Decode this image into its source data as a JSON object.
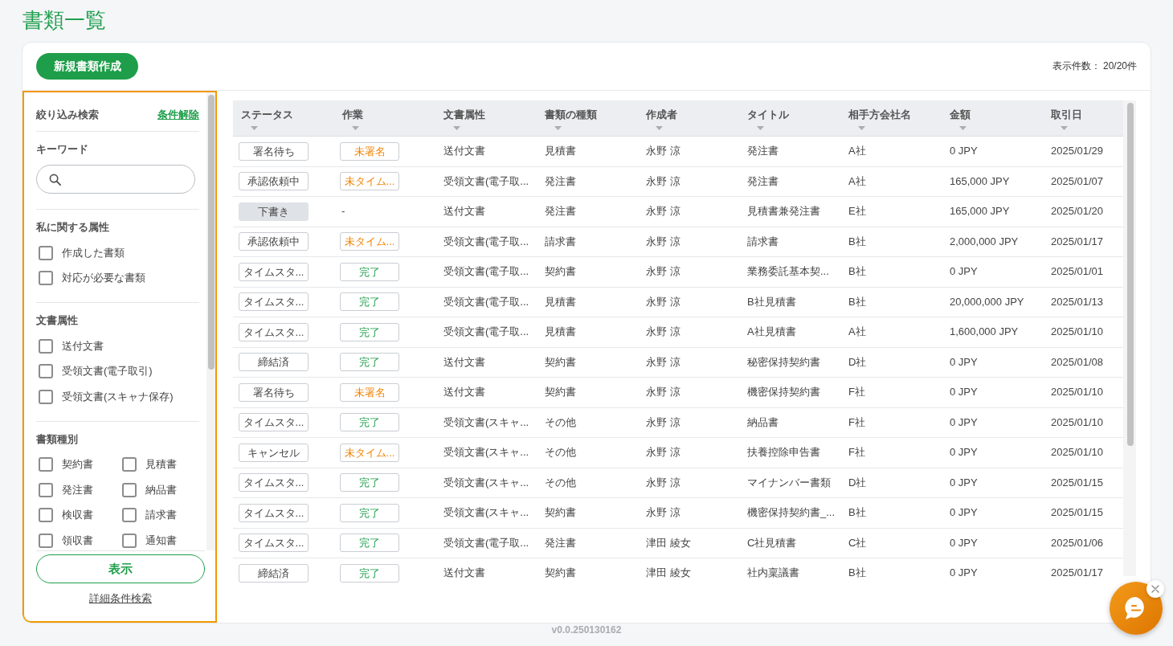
{
  "page": {
    "title": "書類一覧",
    "version": "v0.0.250130162"
  },
  "toolbar": {
    "create_button": "新規書類作成",
    "count": "表示件数： 20/20件"
  },
  "filter_panel": {
    "focused": true,
    "title": "絞り込み検索",
    "clear_link": "条件解除",
    "sections": [
      {
        "kind": "search",
        "heading": "キーワード"
      },
      {
        "kind": "checklist",
        "heading": "私に関する属性",
        "options": [
          {
            "label": "作成した書類",
            "checked": false
          },
          {
            "label": "対応が必要な書類",
            "checked": false
          }
        ]
      },
      {
        "kind": "checklist",
        "heading": "文書属性",
        "options": [
          {
            "label": "送付文書",
            "checked": false
          },
          {
            "label": "受領文書(電子取引)",
            "checked": false
          },
          {
            "label": "受領文書(スキャナ保存)",
            "checked": false
          }
        ]
      },
      {
        "kind": "grid",
        "heading": "書類種別",
        "options": [
          {
            "label": "契約書",
            "checked": false
          },
          {
            "label": "見積書",
            "checked": false
          },
          {
            "label": "発注書",
            "checked": false
          },
          {
            "label": "納品書",
            "checked": false
          },
          {
            "label": "検収書",
            "checked": false
          },
          {
            "label": "請求書",
            "checked": false
          },
          {
            "label": "領収書",
            "checked": false
          },
          {
            "label": "通知書",
            "checked": false
          }
        ]
      }
    ],
    "apply_button": "表示",
    "advanced_link": "詳細条件検索"
  },
  "table": {
    "columns": [
      "ステータス",
      "作業",
      "文書属性",
      "書類の種類",
      "作成者",
      "タイトル",
      "相手方会社名",
      "金額",
      "取引日"
    ],
    "rows": [
      {
        "status": {
          "label": "署名待ち",
          "kind": "normal"
        },
        "task": {
          "label": "未署名",
          "kind": "pending"
        },
        "attribute": "送付文書",
        "type": "見積書",
        "creator": "永野 涼",
        "title": "発注書",
        "partner": "A社",
        "amount": "0 JPY",
        "date": "2025/01/29"
      },
      {
        "status": {
          "label": "承認依頼中",
          "kind": "normal"
        },
        "task": {
          "label": "未タイム...",
          "kind": "pending"
        },
        "attribute": "受領文書(電子取...",
        "type": "発注書",
        "creator": "永野 涼",
        "title": "発注書",
        "partner": "A社",
        "amount": "165,000 JPY",
        "date": "2025/01/07"
      },
      {
        "status": {
          "label": "下書き",
          "kind": "draft"
        },
        "task": {
          "label": "-",
          "kind": "none"
        },
        "attribute": "送付文書",
        "type": "発注書",
        "creator": "永野 涼",
        "title": "見積書兼発注書",
        "partner": "E社",
        "amount": "165,000 JPY",
        "date": "2025/01/20"
      },
      {
        "status": {
          "label": "承認依頼中",
          "kind": "normal"
        },
        "task": {
          "label": "未タイム...",
          "kind": "pending"
        },
        "attribute": "受領文書(電子取...",
        "type": "請求書",
        "creator": "永野 涼",
        "title": "請求書",
        "partner": "B社",
        "amount": "2,000,000 JPY",
        "date": "2025/01/17"
      },
      {
        "status": {
          "label": "タイムスタ...",
          "kind": "normal"
        },
        "task": {
          "label": "完了",
          "kind": "done"
        },
        "attribute": "受領文書(電子取...",
        "type": "契約書",
        "creator": "永野 涼",
        "title": "業務委託基本契...",
        "partner": "B社",
        "amount": "0 JPY",
        "date": "2025/01/01"
      },
      {
        "status": {
          "label": "タイムスタ...",
          "kind": "normal"
        },
        "task": {
          "label": "完了",
          "kind": "done"
        },
        "attribute": "受領文書(電子取...",
        "type": "見積書",
        "creator": "永野 涼",
        "title": "B社見積書",
        "partner": "B社",
        "amount": "20,000,000 JPY",
        "date": "2025/01/13"
      },
      {
        "status": {
          "label": "タイムスタ...",
          "kind": "normal"
        },
        "task": {
          "label": "完了",
          "kind": "done"
        },
        "attribute": "受領文書(電子取...",
        "type": "見積書",
        "creator": "永野 涼",
        "title": "A社見積書",
        "partner": "A社",
        "amount": "1,600,000 JPY",
        "date": "2025/01/10"
      },
      {
        "status": {
          "label": "締結済",
          "kind": "normal"
        },
        "task": {
          "label": "完了",
          "kind": "done"
        },
        "attribute": "送付文書",
        "type": "契約書",
        "creator": "永野 涼",
        "title": "秘密保持契約書",
        "partner": "D社",
        "amount": "0 JPY",
        "date": "2025/01/08"
      },
      {
        "status": {
          "label": "署名待ち",
          "kind": "normal"
        },
        "task": {
          "label": "未署名",
          "kind": "pending"
        },
        "attribute": "送付文書",
        "type": "契約書",
        "creator": "永野 涼",
        "title": "機密保持契約書",
        "partner": "F社",
        "amount": "0 JPY",
        "date": "2025/01/10"
      },
      {
        "status": {
          "label": "タイムスタ...",
          "kind": "normal"
        },
        "task": {
          "label": "完了",
          "kind": "done"
        },
        "attribute": "受領文書(スキャ...",
        "type": "その他",
        "creator": "永野 涼",
        "title": "納品書",
        "partner": "F社",
        "amount": "0 JPY",
        "date": "2025/01/10"
      },
      {
        "status": {
          "label": "キャンセル",
          "kind": "normal"
        },
        "task": {
          "label": "未タイム...",
          "kind": "pending"
        },
        "attribute": "受領文書(スキャ...",
        "type": "その他",
        "creator": "永野 涼",
        "title": "扶養控除申告書",
        "partner": "F社",
        "amount": "0 JPY",
        "date": "2025/01/10"
      },
      {
        "status": {
          "label": "タイムスタ...",
          "kind": "normal"
        },
        "task": {
          "label": "完了",
          "kind": "done"
        },
        "attribute": "受領文書(スキャ...",
        "type": "その他",
        "creator": "永野 涼",
        "title": "マイナンバー書類",
        "partner": "D社",
        "amount": "0 JPY",
        "date": "2025/01/15"
      },
      {
        "status": {
          "label": "タイムスタ...",
          "kind": "normal"
        },
        "task": {
          "label": "完了",
          "kind": "done"
        },
        "attribute": "受領文書(スキャ...",
        "type": "契約書",
        "creator": "永野 涼",
        "title": "機密保持契約書_...",
        "partner": "B社",
        "amount": "0 JPY",
        "date": "2025/01/15"
      },
      {
        "status": {
          "label": "タイムスタ...",
          "kind": "normal"
        },
        "task": {
          "label": "完了",
          "kind": "done"
        },
        "attribute": "受領文書(電子取...",
        "type": "発注書",
        "creator": "津田 綾女",
        "title": "C社見積書",
        "partner": "C社",
        "amount": "0 JPY",
        "date": "2025/01/06"
      },
      {
        "status": {
          "label": "締結済",
          "kind": "normal"
        },
        "task": {
          "label": "完了",
          "kind": "done"
        },
        "attribute": "送付文書",
        "type": "契約書",
        "creator": "津田 綾女",
        "title": "社内稟議書",
        "partner": "B社",
        "amount": "0 JPY",
        "date": "2025/01/17"
      }
    ]
  }
}
